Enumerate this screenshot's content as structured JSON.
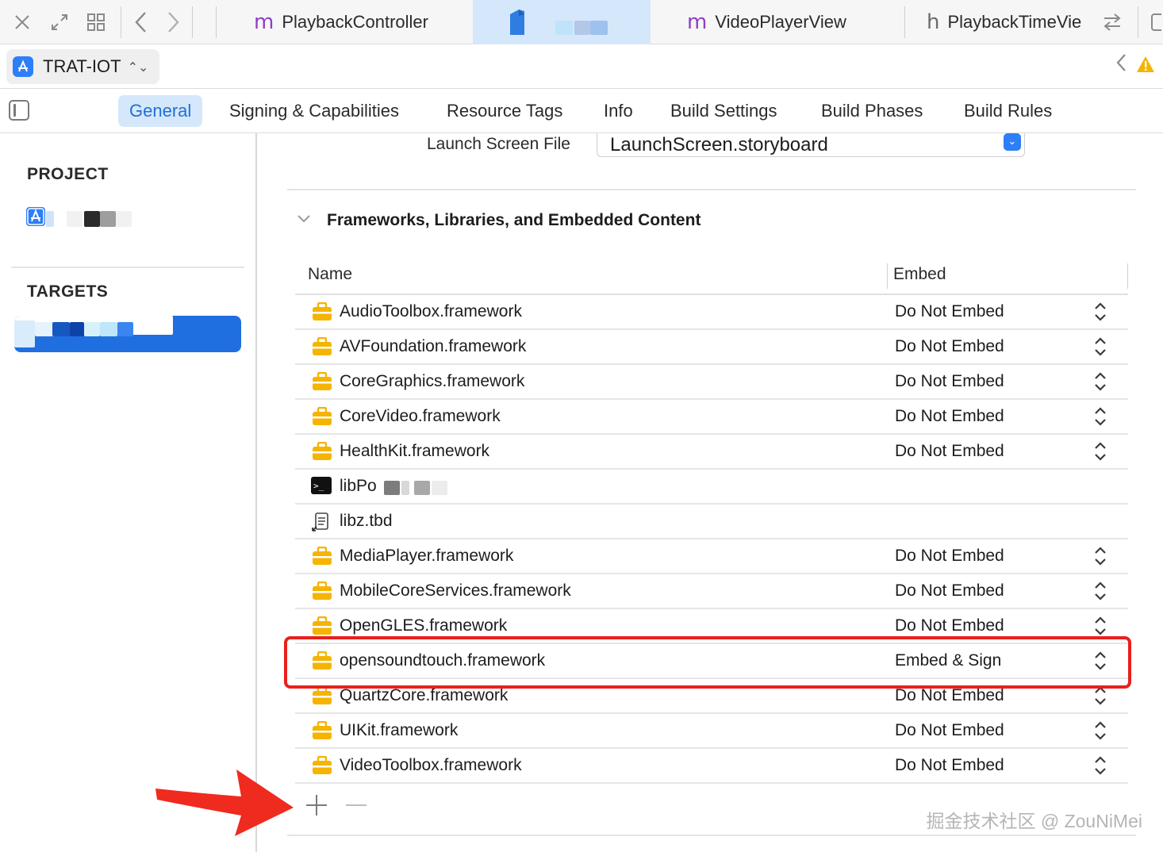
{
  "tabbar": {
    "tabs": [
      {
        "glyph": "m",
        "label": "PlaybackController"
      },
      {
        "glyph": "",
        "label": ""
      },
      {
        "glyph": "m",
        "label": "VideoPlayerView"
      },
      {
        "glyph": "h",
        "label": "PlaybackTimeVie"
      }
    ],
    "icons": [
      "close-icon",
      "expand-icon",
      "grid-icon",
      "back-icon",
      "forward-icon",
      "swap-icon",
      "split-icon"
    ]
  },
  "scheme": {
    "name": "TRAT-IOT"
  },
  "editor_tabs": [
    {
      "label": "General",
      "active": true
    },
    {
      "label": "Signing & Capabilities"
    },
    {
      "label": "Resource Tags"
    },
    {
      "label": "Info"
    },
    {
      "label": "Build Settings"
    },
    {
      "label": "Build Phases"
    },
    {
      "label": "Build Rules"
    }
  ],
  "navigator": {
    "project_heading": "PROJECT",
    "targets_heading": "TARGETS"
  },
  "launch_screen": {
    "label": "Launch Screen File",
    "value": "LaunchScreen.storyboard"
  },
  "frameworks": {
    "title": "Frameworks, Libraries, and Embedded Content",
    "columns": {
      "name": "Name",
      "embed": "Embed"
    },
    "rows": [
      {
        "name": "AudioToolbox.framework",
        "embed": "Do Not Embed",
        "icon": "framework-icon"
      },
      {
        "name": "AVFoundation.framework",
        "embed": "Do Not Embed",
        "icon": "framework-icon"
      },
      {
        "name": "CoreGraphics.framework",
        "embed": "Do Not Embed",
        "icon": "framework-icon"
      },
      {
        "name": "CoreVideo.framework",
        "embed": "Do Not Embed",
        "icon": "framework-icon"
      },
      {
        "name": "HealthKit.framework",
        "embed": "Do Not Embed",
        "icon": "framework-icon"
      },
      {
        "name": "libPo",
        "embed": "",
        "icon": "terminal-icon"
      },
      {
        "name": "libz.tbd",
        "embed": "",
        "icon": "document-icon"
      },
      {
        "name": "MediaPlayer.framework",
        "embed": "Do Not Embed",
        "icon": "framework-icon"
      },
      {
        "name": "MobileCoreServices.framework",
        "embed": "Do Not Embed",
        "icon": "framework-icon"
      },
      {
        "name": "OpenGLES.framework",
        "embed": "Do Not Embed",
        "icon": "framework-icon"
      },
      {
        "name": "opensoundtouch.framework",
        "embed": "Embed & Sign",
        "icon": "framework-icon",
        "highlighted": true
      },
      {
        "name": "QuartzCore.framework",
        "embed": "Do Not Embed",
        "icon": "framework-icon"
      },
      {
        "name": "UIKit.framework",
        "embed": "Do Not Embed",
        "icon": "framework-icon"
      },
      {
        "name": "VideoToolbox.framework",
        "embed": "Do Not Embed",
        "icon": "framework-icon"
      }
    ],
    "add_label": "+",
    "remove_label": "—"
  },
  "watermark": "掘金技术社区 @ ZouNiMei",
  "colors": {
    "accent": "#1f6fd6",
    "highlight": "#e8201c",
    "framework_icon": "#f5b400"
  }
}
